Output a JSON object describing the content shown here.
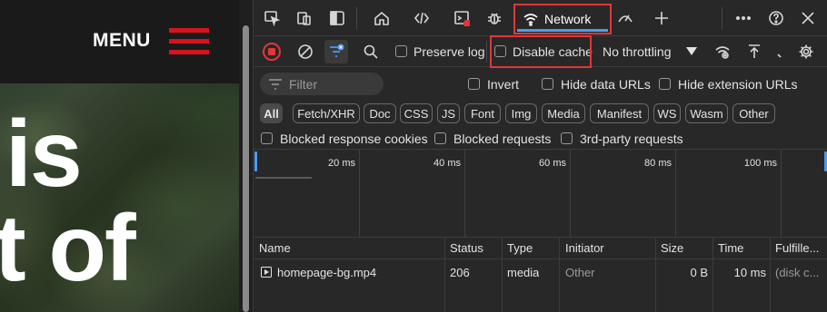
{
  "webpage": {
    "menu_label": "MENU",
    "hero_line1": "is",
    "hero_line2": "t of"
  },
  "devtools": {
    "tabs": {
      "network_label": "Network"
    },
    "toolbar": {
      "preserve_log_label": "Preserve log",
      "disable_cache_label": "Disable cache",
      "throttling_value": "No throttling"
    },
    "filter": {
      "placeholder": "Filter",
      "invert_label": "Invert",
      "hide_data_urls_label": "Hide data URLs",
      "hide_extension_urls_label": "Hide extension URLs"
    },
    "resource_types": [
      "All",
      "Fetch/XHR",
      "Doc",
      "CSS",
      "JS",
      "Font",
      "Img",
      "Media",
      "Manifest",
      "WS",
      "Wasm",
      "Other"
    ],
    "blocked": {
      "blocked_cookies_label": "Blocked response cookies",
      "blocked_requests_label": "Blocked requests",
      "third_party_label": "3rd-party requests"
    },
    "timeline": {
      "ticks": [
        "20 ms",
        "40 ms",
        "60 ms",
        "80 ms",
        "100 ms"
      ]
    },
    "table": {
      "columns": [
        "Name",
        "Status",
        "Type",
        "Initiator",
        "Size",
        "Time",
        "Fulfille..."
      ],
      "rows": [
        {
          "name": "homepage-bg.mp4",
          "status": "206",
          "type": "media",
          "initiator": "Other",
          "size": "0 B",
          "time": "10 ms",
          "fulfilled": "(disk c..."
        }
      ]
    }
  },
  "colors": {
    "highlight": "#e0373a",
    "accent": "#4d9bf0",
    "menu_red": "#d8131d"
  }
}
